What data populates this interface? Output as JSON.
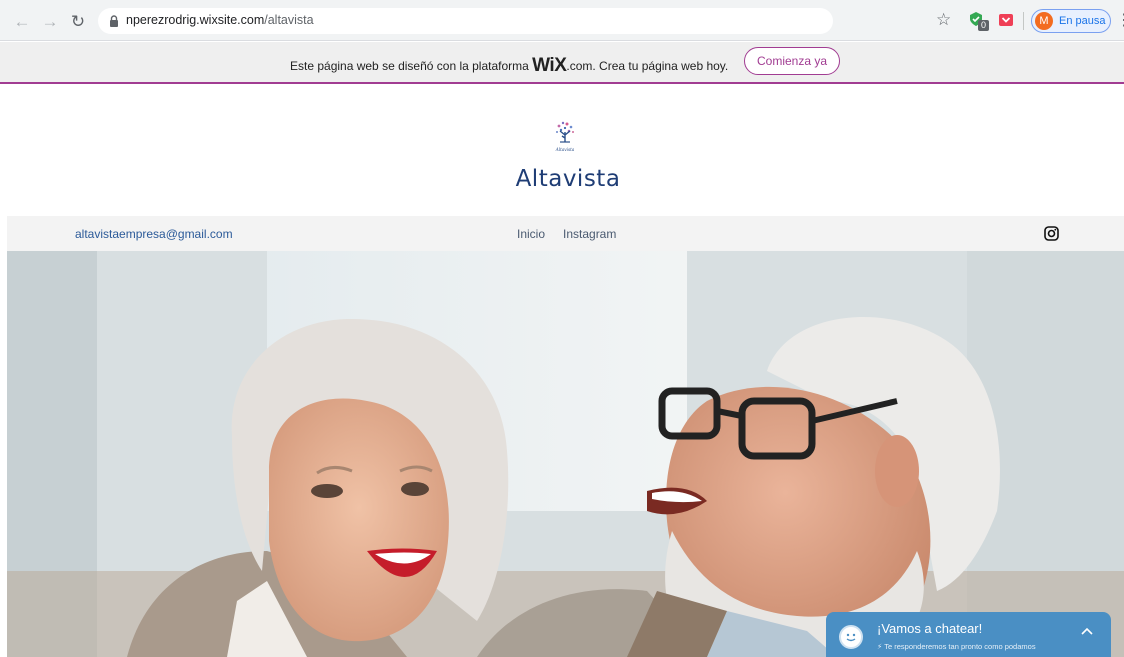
{
  "browser": {
    "url_host": "nperezrodrig.wixsite.com",
    "url_path": "/altavista",
    "profile_initial": "M",
    "profile_label": "En pausa",
    "extension_badge": "0",
    "icons": [
      "back-arrow-icon",
      "forward-arrow-icon",
      "reload-icon",
      "lock-icon",
      "star-icon",
      "extension-icon",
      "pocket-icon",
      "menu-icon"
    ]
  },
  "wix_banner": {
    "text_before": "Este página web se diseñó con la plataforma ",
    "logo": "WiX",
    "text_after": ".com. Crea tu página web hoy.",
    "cta": "Comienza ya",
    "accent": "#a13c92"
  },
  "site": {
    "title": "Altavista",
    "logo_caption": "Altavista",
    "title_color": "#1f3d75"
  },
  "nav": {
    "email": "altavistaempresa@gmail.com",
    "items": [
      {
        "label": "Inicio"
      },
      {
        "label": "Instagram"
      }
    ],
    "social_icon": "instagram-icon"
  },
  "chat": {
    "title": "¡Vamos a chatear!",
    "subtitle": "Te responderemos tan pronto como podamos",
    "color": "#4a8fc4"
  }
}
